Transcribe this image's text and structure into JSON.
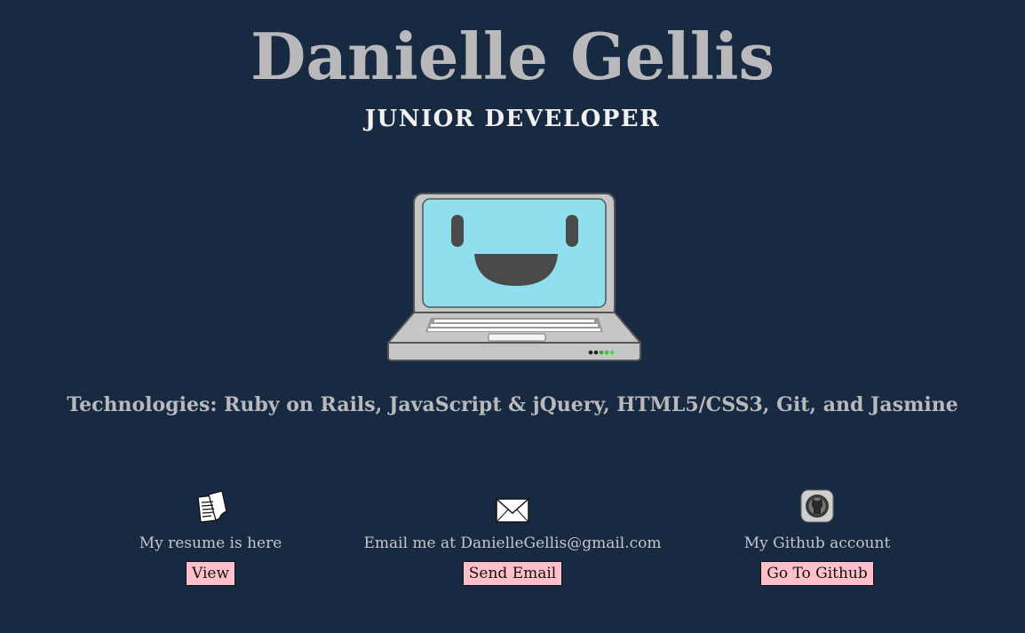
{
  "header": {
    "name": "Danielle Gellis",
    "title": "JUNIOR DEVELOPER"
  },
  "hero": {
    "icon": "smiling-laptop-illustration"
  },
  "technologies": "Technologies: Ruby on Rails, JavaScript & jQuery, HTML5/CSS3, Git, and Jasmine",
  "links": {
    "resume": {
      "icon": "document-icon",
      "text": "My resume is here",
      "button": "View"
    },
    "email": {
      "icon": "envelope-icon",
      "text": "Email me at DanielleGellis@gmail.com",
      "button": "Send Email"
    },
    "github": {
      "icon": "github-icon",
      "text": "My Github account",
      "button": "Go To Github"
    }
  },
  "colors": {
    "background": "#172a42",
    "heading": "#b9b9bb",
    "button": "#ffc0cb",
    "screen": "#8fdfef"
  }
}
